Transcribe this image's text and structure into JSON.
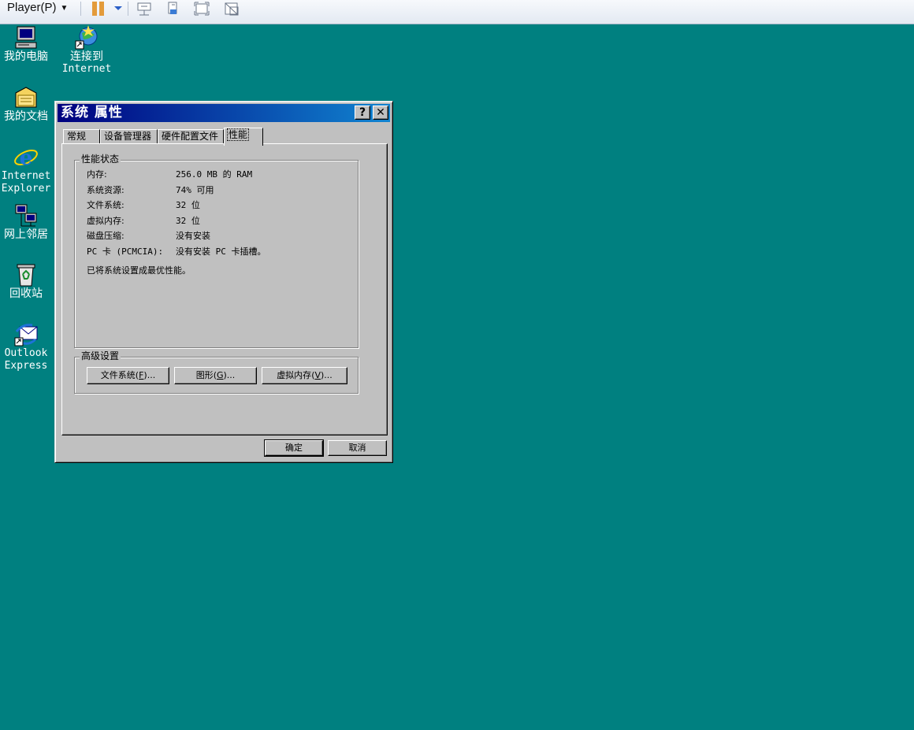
{
  "player": {
    "menu_label": "Player(P)",
    "tools": [
      "pause-icon",
      "dropdown-icon",
      "send-ctrl-alt-del-icon",
      "removable-devices-icon",
      "fullscreen-icon",
      "unity-icon"
    ]
  },
  "desktop": {
    "icons": [
      {
        "name": "my-computer",
        "label": "我的电脑",
        "label2": ""
      },
      {
        "name": "connect-internet",
        "label": "连接到",
        "label2": "Internet"
      },
      {
        "name": "my-documents",
        "label": "我的文档",
        "label2": ""
      },
      {
        "name": "internet-explorer",
        "label": "Internet",
        "label2": "Explorer"
      },
      {
        "name": "network-neighborhood",
        "label": "网上邻居",
        "label2": ""
      },
      {
        "name": "recycle-bin",
        "label": "回收站",
        "label2": ""
      },
      {
        "name": "outlook-express",
        "label": "Outlook",
        "label2": "Express"
      }
    ],
    "background_color": "#008080"
  },
  "dialog": {
    "title": "系统 属性",
    "help_label": "?",
    "close_label": "✕",
    "tabs": [
      {
        "label": "常规",
        "active": false
      },
      {
        "label": "设备管理器",
        "active": false
      },
      {
        "label": "硬件配置文件",
        "active": false
      },
      {
        "label": "性能",
        "active": true
      }
    ],
    "perf_group": {
      "title": "性能状态",
      "rows": [
        {
          "key": "内存:",
          "value": "256.0 MB 的 RAM"
        },
        {
          "key": "系统资源:",
          "value": "74% 可用"
        },
        {
          "key": "文件系统:",
          "value": "32 位"
        },
        {
          "key": "虚拟内存:",
          "value": "32 位"
        },
        {
          "key": "磁盘压缩:",
          "value": "没有安装"
        },
        {
          "key": "PC 卡 (PCMCIA):",
          "value": "没有安装 PC 卡插槽。"
        }
      ],
      "note": "已将系统设置成最优性能。"
    },
    "advanced_group": {
      "title": "高级设置",
      "buttons": [
        {
          "name": "file-system-button",
          "text": "文件系统",
          "key": "F"
        },
        {
          "name": "graphics-button",
          "text": "图形",
          "key": "G"
        },
        {
          "name": "virtual-memory-button",
          "text": "虚拟内存",
          "key": "V"
        }
      ]
    },
    "ok_label": "确定",
    "cancel_label": "取消"
  },
  "colors": {
    "title_start": "#00007f",
    "title_end": "#1084d0",
    "face": "#c0c0c0"
  }
}
